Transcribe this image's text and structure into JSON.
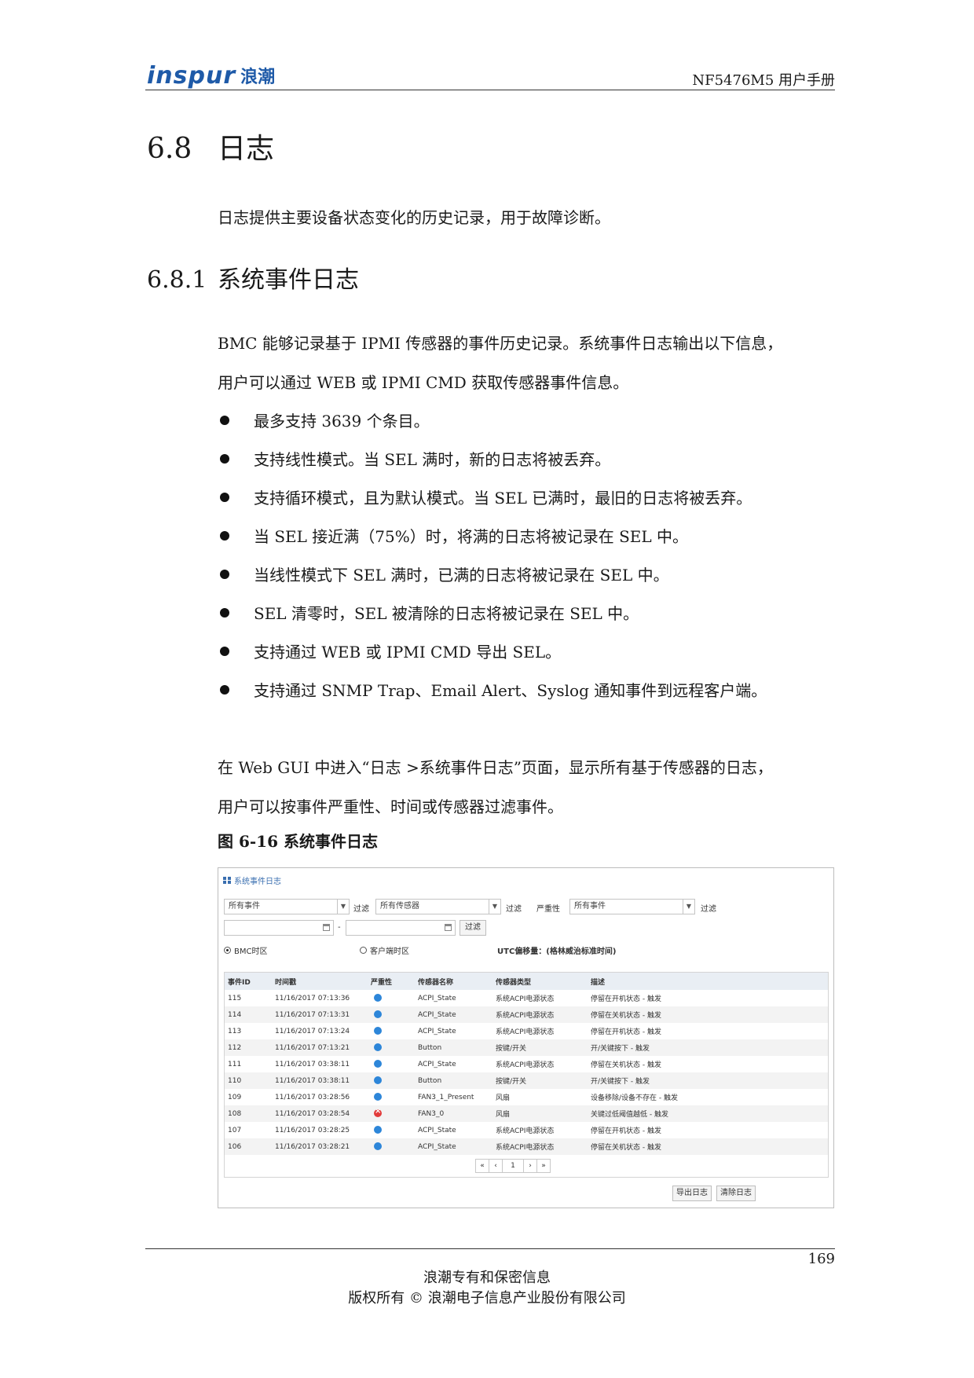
{
  "header": {
    "logo_word": "inspur",
    "logo_cn": "浪潮",
    "doc_title": "NF5476M5 用户手册"
  },
  "section": {
    "num": "6.8",
    "title": "日志"
  },
  "intro": "日志提供主要设备状态变化的历史记录，用于故障诊断。",
  "subsection": {
    "num": "6.8.1",
    "title": "系统事件日志"
  },
  "para1": [
    "BMC 能够记录基于 IPMI 传感器的事件历史记录。系统事件日志输出以下信息，",
    "用户可以通过 WEB 或 IPMI CMD 获取传感器事件信息。"
  ],
  "bullets": [
    "最多支持 3639 个条目。",
    "支持线性模式。当 SEL 满时，新的日志将被丢弃。",
    "支持循环模式，且为默认模式。当 SEL 已满时，最旧的日志将被丢弃。",
    "当 SEL 接近满（75%）时，将满的日志将被记录在 SEL 中。",
    "当线性模式下 SEL 满时，已满的日志将被记录在 SEL 中。",
    "SEL 清零时，SEL 被清除的日志将被记录在 SEL 中。",
    "支持通过 WEB 或 IPMI CMD 导出 SEL。",
    "支持通过 SNMP Trap、Email Alert、Syslog 通知事件到远程客户端。"
  ],
  "para2": [
    "在 Web GUI 中进入“日志 >系统事件日志”页面，显示所有基于传感器的日志，",
    "用户可以按事件严重性、时间或传感器过滤事件。"
  ],
  "figure_caption": "图 6-16 系统事件日志",
  "ui": {
    "panel_title": "系统事件日志",
    "filter1_value": "所有事件",
    "filter_label": "过滤",
    "filter2_value": "所有传感器",
    "severity_label": "严重性",
    "filter3_value": "所有事件",
    "filter_button": "过滤",
    "date_sep": "-",
    "radio_bmc": "BMC时区",
    "radio_client": "客户端时区",
    "utc_note": "UTC偏移量：(格林威治标准时间)",
    "columns": [
      "事件ID",
      "时间戳",
      "严重性",
      "传感器名称",
      "传感器类型",
      "描述"
    ],
    "rows": [
      {
        "id": "115",
        "time": "11/16/2017 07:13:36",
        "sev": "info",
        "name": "ACPI_State",
        "type": "系统ACPI电源状态",
        "desc": "停留在开机状态 - 触发"
      },
      {
        "id": "114",
        "time": "11/16/2017 07:13:31",
        "sev": "info",
        "name": "ACPI_State",
        "type": "系统ACPI电源状态",
        "desc": "停留在关机状态 - 触发"
      },
      {
        "id": "113",
        "time": "11/16/2017 07:13:24",
        "sev": "info",
        "name": "ACPI_State",
        "type": "系统ACPI电源状态",
        "desc": "停留在开机状态 - 触发"
      },
      {
        "id": "112",
        "time": "11/16/2017 07:13:21",
        "sev": "info",
        "name": "Button",
        "type": "按键/开关",
        "desc": "开/关键按下 - 触发"
      },
      {
        "id": "111",
        "time": "11/16/2017 03:38:11",
        "sev": "info",
        "name": "ACPI_State",
        "type": "系统ACPI电源状态",
        "desc": "停留在关机状态 - 触发"
      },
      {
        "id": "110",
        "time": "11/16/2017 03:38:11",
        "sev": "info",
        "name": "Button",
        "type": "按键/开关",
        "desc": "开/关键按下 - 触发"
      },
      {
        "id": "109",
        "time": "11/16/2017 03:28:56",
        "sev": "info",
        "name": "FAN3_1_Present",
        "type": "风扇",
        "desc": "设备移除/设备不存在 - 触发"
      },
      {
        "id": "108",
        "time": "11/16/2017 03:28:54",
        "sev": "error",
        "name": "FAN3_0",
        "type": "风扇",
        "desc": "关键过低阈值越低 - 触发"
      },
      {
        "id": "107",
        "time": "11/16/2017 03:28:25",
        "sev": "info",
        "name": "ACPI_State",
        "type": "系统ACPI电源状态",
        "desc": "停留在开机状态 - 触发"
      },
      {
        "id": "106",
        "time": "11/16/2017 03:28:21",
        "sev": "info",
        "name": "ACPI_State",
        "type": "系统ACPI电源状态",
        "desc": "停留在关机状态 - 触发"
      }
    ],
    "pager": [
      "«",
      "‹",
      "1",
      "›",
      "»"
    ],
    "export_button": "导出日志",
    "clear_button": "清除日志"
  },
  "footer": {
    "page_number": "169",
    "line1": "浪潮专有和保密信息",
    "line2": "版权所有 © 浪潮电子信息产业股份有限公司"
  }
}
